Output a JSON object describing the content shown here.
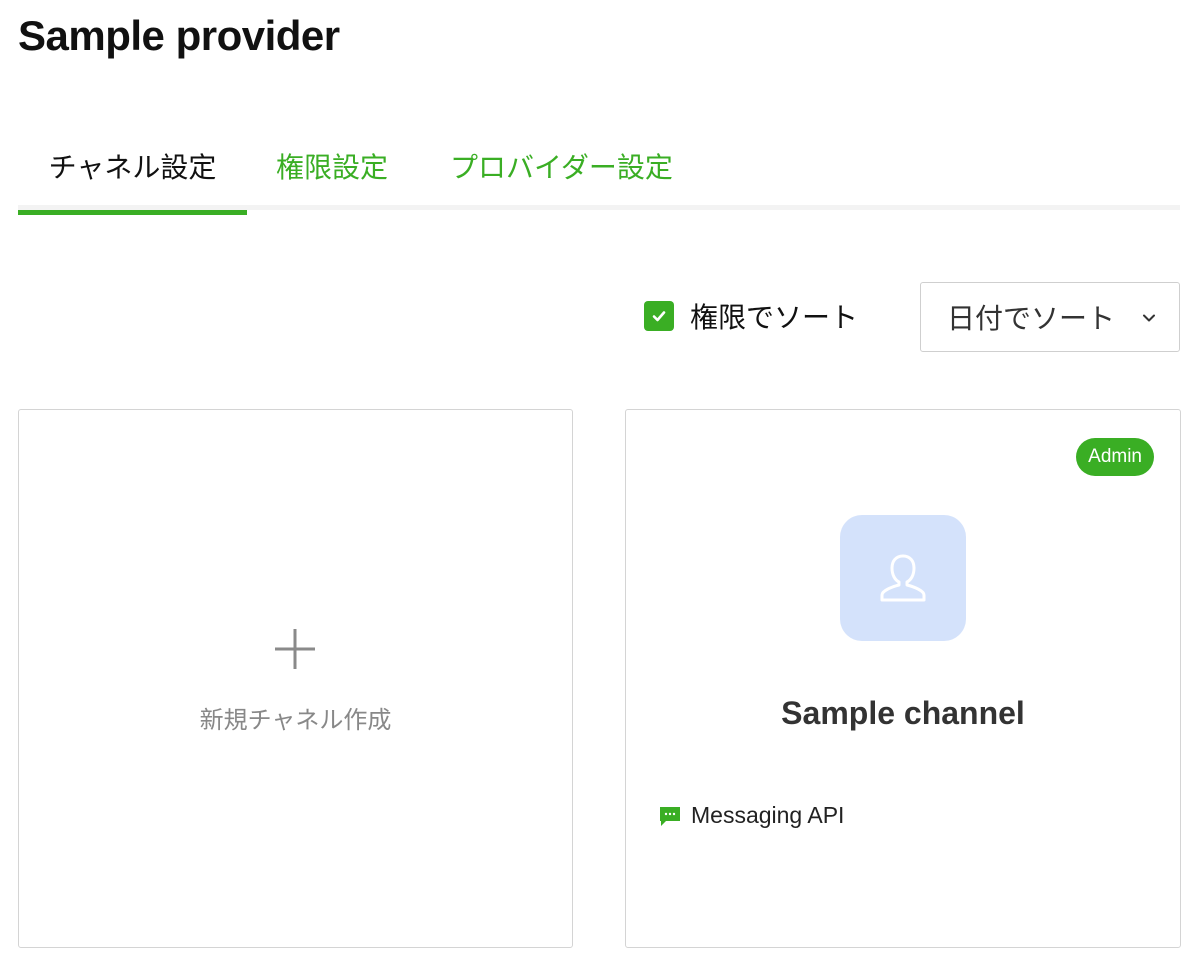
{
  "header": {
    "title": "Sample provider"
  },
  "tabs": [
    {
      "label": "チャネル設定",
      "active": true
    },
    {
      "label": "権限設定",
      "active": false
    },
    {
      "label": "プロバイダー設定",
      "active": false
    }
  ],
  "sort": {
    "permission_checkbox": {
      "label": "権限でソート",
      "checked": true
    },
    "select": {
      "value": "日付でソート",
      "icon": "chevron-down-icon"
    }
  },
  "cards": {
    "new_channel": {
      "label": "新規チャネル作成",
      "icon": "plus-icon"
    },
    "channels": [
      {
        "name": "Sample channel",
        "badge": "Admin",
        "type": "Messaging API",
        "type_icon": "chat-bubble-icon",
        "avatar_icon": "user-icon"
      }
    ]
  },
  "colors": {
    "accent": "#3aae24",
    "avatar_bg": "#d4e2fb",
    "muted_text": "#888888"
  }
}
